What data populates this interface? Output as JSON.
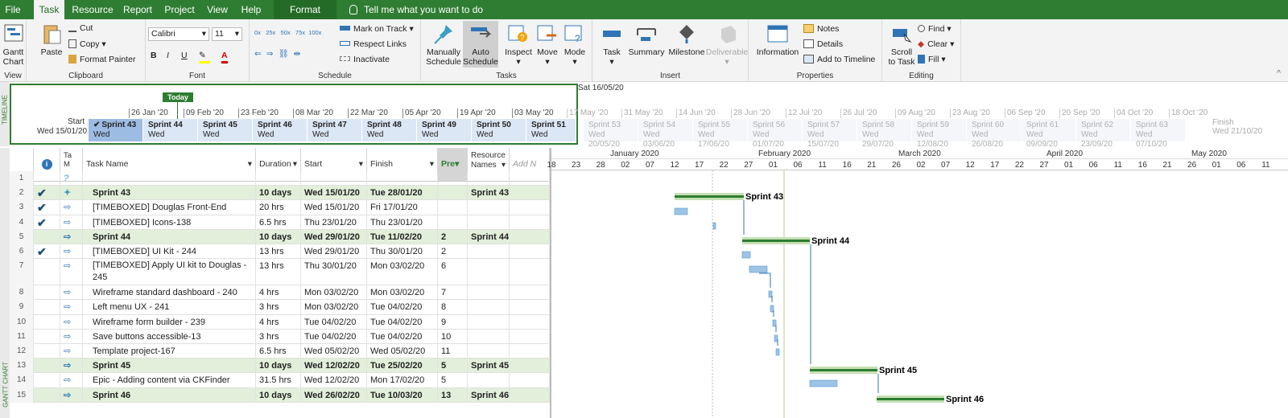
{
  "ribbon_tabs": [
    "File",
    "Task",
    "Resource",
    "Report",
    "Project",
    "View",
    "Help",
    "Format"
  ],
  "tell_me": "Tell me what you want to do",
  "groups": {
    "view": {
      "label": "View",
      "gantt": "Gantt",
      "chart": "Chart"
    },
    "clipboard": {
      "label": "Clipboard",
      "paste": "Paste",
      "cut": "Cut",
      "copy": "Copy",
      "format_painter": "Format Painter"
    },
    "font": {
      "label": "Font",
      "font_name": "Calibri",
      "font_size": "11",
      "bold": "B",
      "italic": "I",
      "underline": "U"
    },
    "schedule": {
      "label": "Schedule",
      "pcts": [
        "0x",
        "25x",
        "50x",
        "75x",
        "100x"
      ],
      "mark_on_track": "Mark on Track",
      "respect_links": "Respect Links",
      "inactivate": "Inactivate"
    },
    "tasks": {
      "label": "Tasks",
      "manually_1": "Manually",
      "manually_2": "Schedule",
      "auto_1": "Auto",
      "auto_2": "Schedule",
      "inspect": "Inspect",
      "move": "Move",
      "mode": "Mode"
    },
    "insert": {
      "label": "Insert",
      "task": "Task",
      "summary": "Summary",
      "milestone": "Milestone",
      "deliverable": "Deliverable"
    },
    "properties": {
      "label": "Properties",
      "information": "Information",
      "notes": "Notes",
      "details": "Details",
      "add_timeline": "Add to Timeline"
    },
    "editing": {
      "label": "Editing",
      "scroll_1": "Scroll",
      "scroll_2": "to Task",
      "find": "Find",
      "clear": "Clear",
      "fill": "Fill"
    }
  },
  "timeline": {
    "side_label": "TIMELINE",
    "today": "Today",
    "start_label": "Start",
    "start_date": "Wed 15/01/20",
    "finish_label": "Finish",
    "finish_date": "Wed 21/10/20",
    "hover_date": "Sat 16/05/20",
    "ticks": [
      "26 Jan '20",
      "09 Feb '20",
      "23 Feb '20",
      "08 Mar '20",
      "22 Mar '20",
      "05 Apr '20",
      "19 Apr '20",
      "03 May '20",
      "17 May '20",
      "31 May '20",
      "14 Jun '20",
      "28 Jun '20",
      "12 Jul '20",
      "26 Jul '20",
      "09 Aug '20",
      "23 Aug '20",
      "06 Sep '20",
      "20 Sep '20",
      "04 Oct '20",
      "18 Oct '20"
    ],
    "segments": [
      {
        "name": "Sprint 43",
        "sub": "Wed"
      },
      {
        "name": "Sprint 44",
        "sub": "Wed"
      },
      {
        "name": "Sprint 45",
        "sub": "Wed"
      },
      {
        "name": "Sprint 46",
        "sub": "Wed"
      },
      {
        "name": "Sprint 47",
        "sub": "Wed"
      },
      {
        "name": "Sprint 48",
        "sub": "Wed"
      },
      {
        "name": "Sprint 49",
        "sub": "Wed"
      },
      {
        "name": "Sprint 50",
        "sub": "Wed"
      },
      {
        "name": "Sprint 51",
        "sub": "Wed"
      },
      {
        "name": "Sprint 53",
        "sub": "Wed 20/05/20"
      },
      {
        "name": "Sprint 54",
        "sub": "Wed 03/06/20"
      },
      {
        "name": "Sprint 55",
        "sub": "Wed 17/06/20"
      },
      {
        "name": "Sprint 56",
        "sub": "Wed 01/07/20"
      },
      {
        "name": "Sprint 57",
        "sub": "Wed 15/07/20"
      },
      {
        "name": "Sprint 58",
        "sub": "Wed 29/07/20"
      },
      {
        "name": "Sprint 59",
        "sub": "Wed 12/08/20"
      },
      {
        "name": "Sprint 60",
        "sub": "Wed 26/08/20"
      },
      {
        "name": "Sprint 61",
        "sub": "Wed 09/09/20"
      },
      {
        "name": "Sprint 62",
        "sub": "Wed 23/09/20"
      },
      {
        "name": "Sprint 63",
        "sub": "Wed 07/10/20"
      }
    ]
  },
  "sheet": {
    "side_label": "GANTT CHART",
    "headers": {
      "mode_1": "Ta",
      "mode_2": "M",
      "name": "Task Name",
      "duration": "Duration",
      "start": "Start",
      "finish": "Finish",
      "pred": "Pre",
      "res_1": "Resource",
      "res_2": "Names",
      "add": "Add N"
    },
    "rows": [
      {
        "id": "1",
        "check": "",
        "mode": "?",
        "name": "",
        "dur": "",
        "start": "",
        "finish": "",
        "pred": "",
        "res": "",
        "summary": false
      },
      {
        "id": "2",
        "check": "✔",
        "mode": "pin",
        "name": "Sprint 43",
        "dur": "10 days",
        "start": "Wed 15/01/20",
        "finish": "Tue 28/01/20",
        "pred": "",
        "res": "Sprint 43",
        "summary": true
      },
      {
        "id": "3",
        "check": "✔",
        "mode": "auto",
        "name": "[TIMEBOXED] Douglas Front-End",
        "dur": "20 hrs",
        "start": "Wed 15/01/20",
        "finish": "Fri 17/01/20",
        "pred": "",
        "res": "",
        "summary": false
      },
      {
        "id": "4",
        "check": "✔",
        "mode": "auto",
        "name": "[TIMEBOXED] Icons-138",
        "dur": "6.5 hrs",
        "start": "Thu 23/01/20",
        "finish": "Thu 23/01/20",
        "pred": "",
        "res": "",
        "summary": false
      },
      {
        "id": "5",
        "check": "",
        "mode": "auto",
        "name": "Sprint 44",
        "dur": "10 days",
        "start": "Wed 29/01/20",
        "finish": "Tue 11/02/20",
        "pred": "2",
        "res": "Sprint 44",
        "summary": true
      },
      {
        "id": "6",
        "check": "✔",
        "mode": "auto",
        "name": "[TIMEBOXED] UI Kit - 244",
        "dur": "13 hrs",
        "start": "Wed 29/01/20",
        "finish": "Thu 30/01/20",
        "pred": "2",
        "res": "",
        "summary": false
      },
      {
        "id": "7",
        "check": "",
        "mode": "auto",
        "name": "[TIMEBOXED] Apply UI kit to Douglas -",
        "name2": "245",
        "dur": "13 hrs",
        "start": "Thu 30/01/20",
        "finish": "Mon 03/02/20",
        "pred": "6",
        "res": "",
        "summary": false
      },
      {
        "id": "8",
        "check": "",
        "mode": "auto",
        "name": "Wireframe standard dashboard - 240",
        "dur": "4 hrs",
        "start": "Mon 03/02/20",
        "finish": "Mon 03/02/20",
        "pred": "7",
        "res": "",
        "summary": false
      },
      {
        "id": "9",
        "check": "",
        "mode": "auto",
        "name": "Left menu UX - 241",
        "dur": "3 hrs",
        "start": "Mon 03/02/20",
        "finish": "Tue 04/02/20",
        "pred": "8",
        "res": "",
        "summary": false
      },
      {
        "id": "10",
        "check": "",
        "mode": "auto",
        "name": "Wireframe form builder - 239",
        "dur": "4 hrs",
        "start": "Tue 04/02/20",
        "finish": "Tue 04/02/20",
        "pred": "9",
        "res": "",
        "summary": false
      },
      {
        "id": "11",
        "check": "",
        "mode": "auto",
        "name": "Save buttons accessible-13",
        "dur": "3 hrs",
        "start": "Tue 04/02/20",
        "finish": "Tue 04/02/20",
        "pred": "10",
        "res": "",
        "summary": false
      },
      {
        "id": "12",
        "check": "",
        "mode": "auto",
        "name": "Template project-167",
        "dur": "6.5 hrs",
        "start": "Wed 05/02/20",
        "finish": "Wed 05/02/20",
        "pred": "11",
        "res": "",
        "summary": false
      },
      {
        "id": "13",
        "check": "",
        "mode": "auto",
        "name": "Sprint 45",
        "dur": "10 days",
        "start": "Wed 12/02/20",
        "finish": "Tue 25/02/20",
        "pred": "5",
        "res": "Sprint 45",
        "summary": true
      },
      {
        "id": "14",
        "check": "",
        "mode": "auto",
        "name": "Epic - Adding content via CKFinder",
        "dur": "31.5 hrs",
        "start": "Wed 12/02/20",
        "finish": "Mon 17/02/20",
        "pred": "5",
        "res": "",
        "summary": false
      },
      {
        "id": "15",
        "check": "",
        "mode": "auto",
        "name": "Sprint 46",
        "dur": "10 days",
        "start": "Wed 26/02/20",
        "finish": "Tue 10/03/20",
        "pred": "13",
        "res": "Sprint 46",
        "summary": true
      }
    ]
  },
  "gantt": {
    "months": [
      "January 2020",
      "February 2020",
      "March 2020",
      "April 2020",
      "May 2020"
    ],
    "days": [
      "18",
      "23",
      "28",
      "02",
      "07",
      "12",
      "17",
      "22",
      "27",
      "01",
      "06",
      "11",
      "16",
      "21",
      "26",
      "02",
      "07",
      "12",
      "17",
      "22",
      "27",
      "01",
      "06",
      "11",
      "16",
      "21",
      "26",
      "01",
      "06",
      "11"
    ],
    "labels": [
      "Sprint 43",
      "Sprint 44",
      "Sprint 45",
      "Sprint 46"
    ]
  }
}
